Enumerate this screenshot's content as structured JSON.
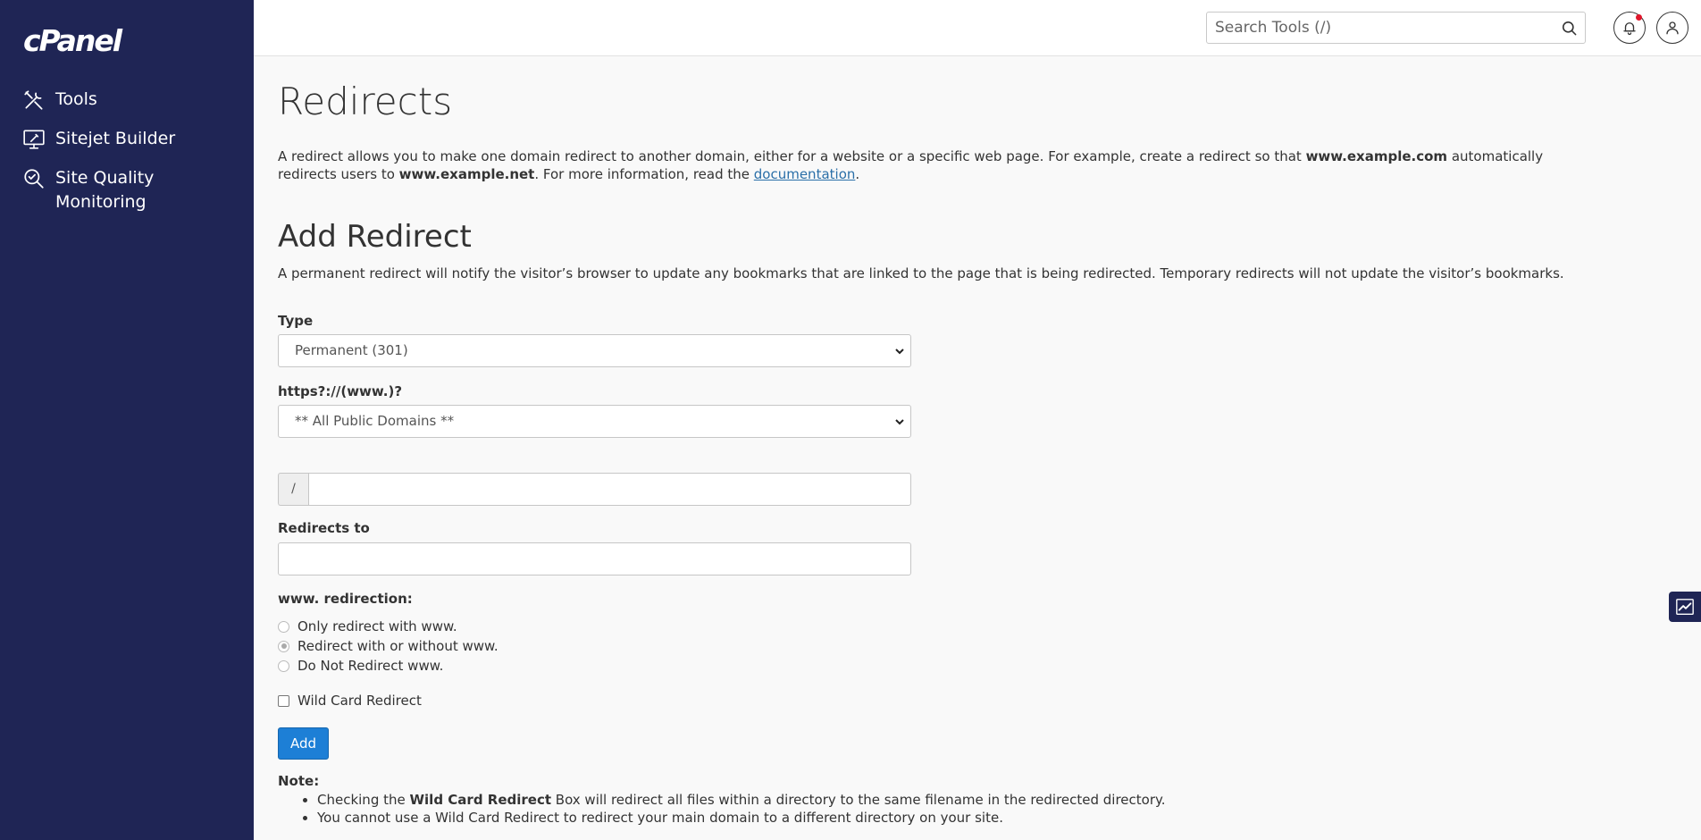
{
  "brand": {
    "logo_text": "cPanel"
  },
  "sidebar": {
    "items": [
      {
        "label": "Tools",
        "icon": "tools-icon"
      },
      {
        "label": "Sitejet Builder",
        "icon": "monitor-icon"
      },
      {
        "label": "Site Quality Monitoring",
        "icon": "magnifier-icon"
      }
    ]
  },
  "header": {
    "search_placeholder": "Search Tools (/)"
  },
  "page": {
    "title": "Redirects",
    "intro_1": "A redirect allows you to make one domain redirect to another domain, either for a website or a specific web page. For example, create a redirect so that ",
    "intro_bold_1": "www.example.com",
    "intro_2": " automatically redirects users to ",
    "intro_bold_2": "www.example.net",
    "intro_3": ". For more information, read the ",
    "intro_link": "documentation",
    "intro_4": "."
  },
  "form": {
    "section_title": "Add Redirect",
    "section_desc": "A permanent redirect will notify the visitor’s browser to update any bookmarks that are linked to the page that is being redirected. Temporary redirects will not update the visitor’s bookmarks.",
    "type_label": "Type",
    "type_value": "Permanent (301)",
    "domain_label": "https?://(www.)?",
    "domain_value": "** All Public Domains **",
    "path_prefix": "/",
    "redirects_to_label": "Redirects to",
    "www_label": "www. redirection:",
    "www_options": [
      {
        "label": "Only redirect with www.",
        "checked": false
      },
      {
        "label": "Redirect with or without www.",
        "checked": true
      },
      {
        "label": "Do Not Redirect www.",
        "checked": false
      }
    ],
    "wildcard_label": "Wild Card Redirect",
    "add_label": "Add"
  },
  "note": {
    "title": "Note:",
    "item1_a": "Checking the ",
    "item1_bold": "Wild Card Redirect",
    "item1_b": " Box will redirect all files within a directory to the same filename in the redirected directory.",
    "item2": "You cannot use a Wild Card Redirect to redirect your main domain to a different directory on your site."
  }
}
